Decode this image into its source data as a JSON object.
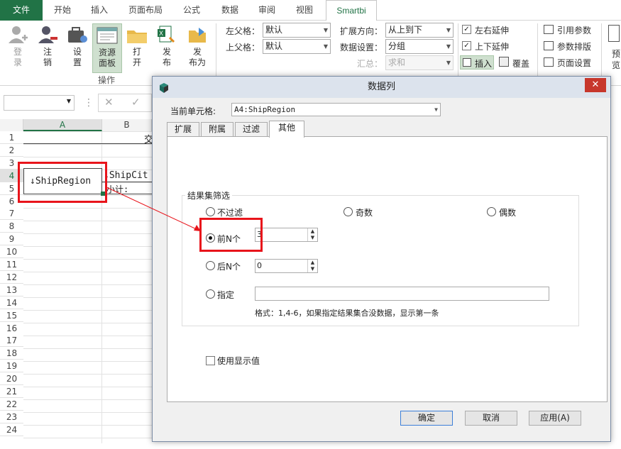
{
  "menu": {
    "tabs": [
      "文件",
      "开始",
      "插入",
      "页面布局",
      "公式",
      "数据",
      "审阅",
      "视图",
      "Smartbi"
    ]
  },
  "ribbon": {
    "buttons": [
      {
        "label1": "登",
        "label2": "录",
        "icon": "login-icon"
      },
      {
        "label1": "注",
        "label2": "销",
        "icon": "logout-icon"
      },
      {
        "label1": "设",
        "label2": "置",
        "icon": "settings-icon"
      },
      {
        "label1": "资源",
        "label2": "面板",
        "icon": "resource-panel-icon"
      },
      {
        "label1": "打",
        "label2": "开",
        "icon": "open-folder-icon"
      },
      {
        "label1": "发",
        "label2": "布",
        "icon": "publish-icon"
      },
      {
        "label1": "发",
        "label2": "布为",
        "icon": "publish-as-icon"
      }
    ],
    "group_label": "操作",
    "left_parent_label": "左父格：",
    "left_parent_value": "默认",
    "top_parent_label": "上父格：",
    "top_parent_value": "默认",
    "expand_dir_label": "扩展方向：",
    "expand_dir_value": "从上到下",
    "data_setting_label": "数据设置：",
    "data_setting_value": "分组",
    "summary_label": "汇总：",
    "summary_value": "求和",
    "lr_extend": "左右延伸",
    "ud_extend": "上下延伸",
    "insert": "插入",
    "cover": "覆盖",
    "ref_param": "引用参数",
    "param_layout": "参数排版",
    "page_setup": "页面设置",
    "preview1": "预",
    "preview2": "览"
  },
  "grid": {
    "col_a": "A",
    "col_b": "B",
    "rows": [
      "1",
      "2",
      "3",
      "4",
      "5",
      "6",
      "7",
      "8",
      "9",
      "10",
      "11",
      "12",
      "13",
      "14",
      "15",
      "16",
      "17",
      "18",
      "19",
      "20",
      "21",
      "22",
      "23",
      "24"
    ],
    "a4": "↓ShipRegion",
    "b4": "↓ShipCit",
    "b5": "小计:",
    "b1": "交"
  },
  "dialog": {
    "title": "数据列",
    "cell_label": "当前单元格:",
    "cell_value": "A4:ShipRegion",
    "tabs": [
      "扩展",
      "附属",
      "过滤",
      "其他"
    ],
    "group_title": "结果集筛选",
    "no_filter": "不过滤",
    "odd": "奇数",
    "even": "偶数",
    "top_n": "前N个",
    "top_n_value": "3",
    "last_n": "后N个",
    "last_n_value": "0",
    "specify": "指定",
    "specify_value": "",
    "format_hint": "格式：1,4-6，如果指定结果集合没数据，显示第一条",
    "use_display": "使用显示值",
    "ok": "确定",
    "cancel": "取消",
    "apply": "应用(A)"
  }
}
